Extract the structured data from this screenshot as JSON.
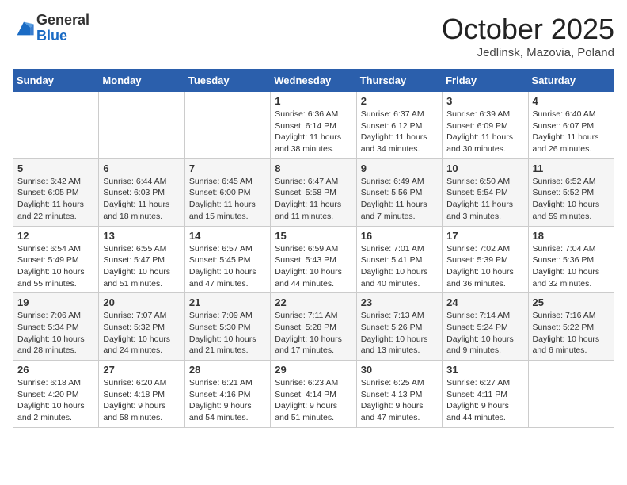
{
  "header": {
    "logo_line1": "General",
    "logo_line2": "Blue",
    "month": "October 2025",
    "location": "Jedlinsk, Mazovia, Poland"
  },
  "weekdays": [
    "Sunday",
    "Monday",
    "Tuesday",
    "Wednesday",
    "Thursday",
    "Friday",
    "Saturday"
  ],
  "weeks": [
    [
      {
        "day": "",
        "info": ""
      },
      {
        "day": "",
        "info": ""
      },
      {
        "day": "",
        "info": ""
      },
      {
        "day": "1",
        "info": "Sunrise: 6:36 AM\nSunset: 6:14 PM\nDaylight: 11 hours\nand 38 minutes."
      },
      {
        "day": "2",
        "info": "Sunrise: 6:37 AM\nSunset: 6:12 PM\nDaylight: 11 hours\nand 34 minutes."
      },
      {
        "day": "3",
        "info": "Sunrise: 6:39 AM\nSunset: 6:09 PM\nDaylight: 11 hours\nand 30 minutes."
      },
      {
        "day": "4",
        "info": "Sunrise: 6:40 AM\nSunset: 6:07 PM\nDaylight: 11 hours\nand 26 minutes."
      }
    ],
    [
      {
        "day": "5",
        "info": "Sunrise: 6:42 AM\nSunset: 6:05 PM\nDaylight: 11 hours\nand 22 minutes."
      },
      {
        "day": "6",
        "info": "Sunrise: 6:44 AM\nSunset: 6:03 PM\nDaylight: 11 hours\nand 18 minutes."
      },
      {
        "day": "7",
        "info": "Sunrise: 6:45 AM\nSunset: 6:00 PM\nDaylight: 11 hours\nand 15 minutes."
      },
      {
        "day": "8",
        "info": "Sunrise: 6:47 AM\nSunset: 5:58 PM\nDaylight: 11 hours\nand 11 minutes."
      },
      {
        "day": "9",
        "info": "Sunrise: 6:49 AM\nSunset: 5:56 PM\nDaylight: 11 hours\nand 7 minutes."
      },
      {
        "day": "10",
        "info": "Sunrise: 6:50 AM\nSunset: 5:54 PM\nDaylight: 11 hours\nand 3 minutes."
      },
      {
        "day": "11",
        "info": "Sunrise: 6:52 AM\nSunset: 5:52 PM\nDaylight: 10 hours\nand 59 minutes."
      }
    ],
    [
      {
        "day": "12",
        "info": "Sunrise: 6:54 AM\nSunset: 5:49 PM\nDaylight: 10 hours\nand 55 minutes."
      },
      {
        "day": "13",
        "info": "Sunrise: 6:55 AM\nSunset: 5:47 PM\nDaylight: 10 hours\nand 51 minutes."
      },
      {
        "day": "14",
        "info": "Sunrise: 6:57 AM\nSunset: 5:45 PM\nDaylight: 10 hours\nand 47 minutes."
      },
      {
        "day": "15",
        "info": "Sunrise: 6:59 AM\nSunset: 5:43 PM\nDaylight: 10 hours\nand 44 minutes."
      },
      {
        "day": "16",
        "info": "Sunrise: 7:01 AM\nSunset: 5:41 PM\nDaylight: 10 hours\nand 40 minutes."
      },
      {
        "day": "17",
        "info": "Sunrise: 7:02 AM\nSunset: 5:39 PM\nDaylight: 10 hours\nand 36 minutes."
      },
      {
        "day": "18",
        "info": "Sunrise: 7:04 AM\nSunset: 5:36 PM\nDaylight: 10 hours\nand 32 minutes."
      }
    ],
    [
      {
        "day": "19",
        "info": "Sunrise: 7:06 AM\nSunset: 5:34 PM\nDaylight: 10 hours\nand 28 minutes."
      },
      {
        "day": "20",
        "info": "Sunrise: 7:07 AM\nSunset: 5:32 PM\nDaylight: 10 hours\nand 24 minutes."
      },
      {
        "day": "21",
        "info": "Sunrise: 7:09 AM\nSunset: 5:30 PM\nDaylight: 10 hours\nand 21 minutes."
      },
      {
        "day": "22",
        "info": "Sunrise: 7:11 AM\nSunset: 5:28 PM\nDaylight: 10 hours\nand 17 minutes."
      },
      {
        "day": "23",
        "info": "Sunrise: 7:13 AM\nSunset: 5:26 PM\nDaylight: 10 hours\nand 13 minutes."
      },
      {
        "day": "24",
        "info": "Sunrise: 7:14 AM\nSunset: 5:24 PM\nDaylight: 10 hours\nand 9 minutes."
      },
      {
        "day": "25",
        "info": "Sunrise: 7:16 AM\nSunset: 5:22 PM\nDaylight: 10 hours\nand 6 minutes."
      }
    ],
    [
      {
        "day": "26",
        "info": "Sunrise: 6:18 AM\nSunset: 4:20 PM\nDaylight: 10 hours\nand 2 minutes."
      },
      {
        "day": "27",
        "info": "Sunrise: 6:20 AM\nSunset: 4:18 PM\nDaylight: 9 hours\nand 58 minutes."
      },
      {
        "day": "28",
        "info": "Sunrise: 6:21 AM\nSunset: 4:16 PM\nDaylight: 9 hours\nand 54 minutes."
      },
      {
        "day": "29",
        "info": "Sunrise: 6:23 AM\nSunset: 4:14 PM\nDaylight: 9 hours\nand 51 minutes."
      },
      {
        "day": "30",
        "info": "Sunrise: 6:25 AM\nSunset: 4:13 PM\nDaylight: 9 hours\nand 47 minutes."
      },
      {
        "day": "31",
        "info": "Sunrise: 6:27 AM\nSunset: 4:11 PM\nDaylight: 9 hours\nand 44 minutes."
      },
      {
        "day": "",
        "info": ""
      }
    ]
  ]
}
